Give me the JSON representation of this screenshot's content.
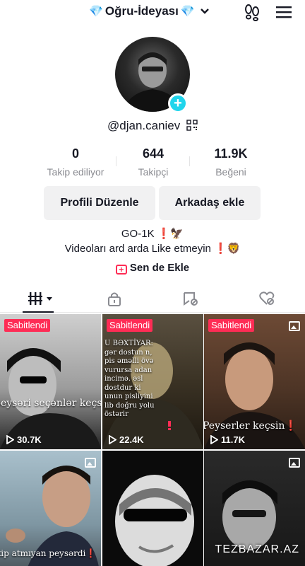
{
  "header": {
    "gem_left": "💎",
    "account_name": "Oğru-İdeyası",
    "gem_right": "💎",
    "chevron": "⌄"
  },
  "profile": {
    "username": "@djan.caniev"
  },
  "stats": [
    {
      "value": "0",
      "label": "Takip ediliyor"
    },
    {
      "value": "644",
      "label": "Takipçi"
    },
    {
      "value": "11.9K",
      "label": "Beğeni"
    }
  ],
  "buttons": {
    "edit_profile": "Profili Düzenle",
    "add_friend": "Arkadaş ekle"
  },
  "bio": {
    "line1": "GO-1K ❗🦅",
    "line2": "Videoları ard arda Like etmeyin ❗🦁"
  },
  "add_link": "Sen de Ekle",
  "videos": [
    {
      "pinned_label": "Sabitlendi",
      "views": "30.7K",
      "caption": "peysəri seçənlər keçsin"
    },
    {
      "pinned_label": "Sabitlendi",
      "views": "22.4K",
      "caption": ""
    },
    {
      "pinned_label": "Sabitlendi",
      "views": "11.7K",
      "caption": "Peyserler keçsin"
    },
    {
      "pinned_label": "",
      "views": "",
      "caption": "kip atmıyan peysərdi"
    },
    {
      "pinned_label": "",
      "views": "",
      "caption": ""
    },
    {
      "pinned_label": "",
      "views": "",
      "caption": ""
    }
  ],
  "overlay_text": "U BƏXTİYAR: gər dostun n, pis əməlli övə vurursa adan incimə. əsl dostdur ki unun pisliyini lib doğru yolu östərir",
  "watermark": "TEZBAZAR.AZ",
  "colors": {
    "accent": "#fe2c55",
    "cyan": "#20d5ec",
    "text": "#161823",
    "muted": "#8a8b91"
  }
}
